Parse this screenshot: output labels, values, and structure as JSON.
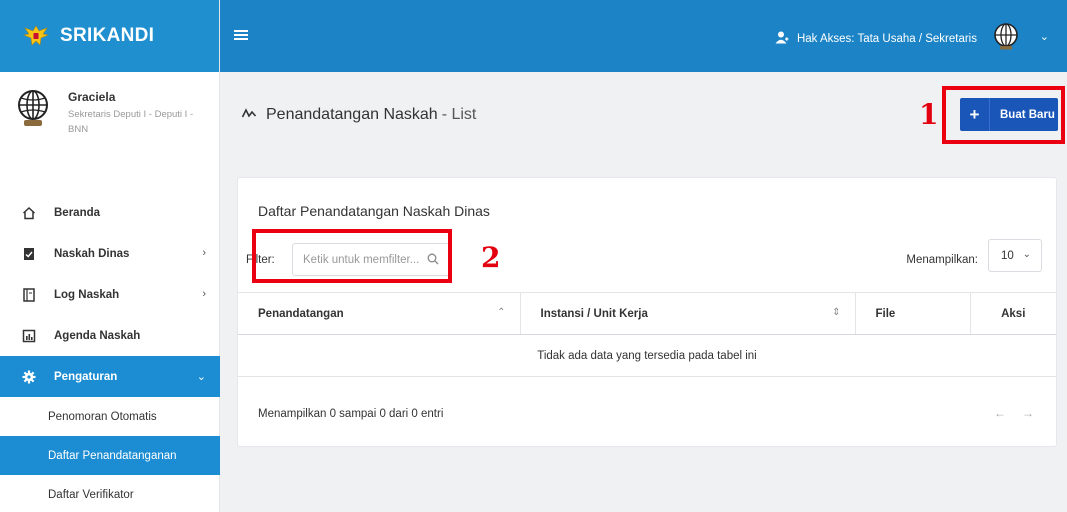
{
  "app": {
    "name": "SRIKANDI"
  },
  "profile": {
    "name": "Graciela",
    "role": "Sekretaris Deputi I - Deputi I - BNN"
  },
  "menu": {
    "items": [
      {
        "label": "Beranda",
        "icon": "home-icon"
      },
      {
        "label": "Naskah Dinas",
        "icon": "document-check-icon",
        "has_children": true
      },
      {
        "label": "Log Naskah",
        "icon": "book-icon",
        "has_children": true
      },
      {
        "label": "Agenda Naskah",
        "icon": "chart-icon"
      },
      {
        "label": "Pengaturan",
        "icon": "gear-icon",
        "has_children": true,
        "expanded": true
      }
    ],
    "submenu": [
      {
        "label": "Penomoran Otomatis"
      },
      {
        "label": "Daftar Penandatanganan",
        "active": true
      },
      {
        "label": "Daftar Verifikator"
      }
    ]
  },
  "topbar": {
    "access_text": "Hak Akses: Tata Usaha / Sekretaris"
  },
  "page": {
    "title": "Penandatangan Naskah",
    "subtitle": "- List"
  },
  "annotations": {
    "mark1": "1",
    "mark2": "2"
  },
  "buttons": {
    "new": "Buat Baru",
    "new_icon": "+"
  },
  "card": {
    "title": "Daftar Penandatangan Naskah Dinas",
    "filter_label": "Filter:",
    "filter_placeholder": "Ketik untuk memfilter...",
    "show_label": "Menampilkan:",
    "show_value": "10"
  },
  "table": {
    "columns": [
      "Penandatangan",
      "Instansi / Unit Kerja",
      "File",
      "Aksi"
    ],
    "empty_message": "Tidak ada data yang tersedia pada tabel ini"
  },
  "footer": {
    "info": "Menampilkan 0 sampai 0 dari 0 entri",
    "prev": "←",
    "next": "→"
  },
  "colors": {
    "topbar": "#1c84c6",
    "brand": "#1f8fd0",
    "active": "#1c8dd3",
    "button": "#1a56b8",
    "annotation": "#e3000f"
  }
}
